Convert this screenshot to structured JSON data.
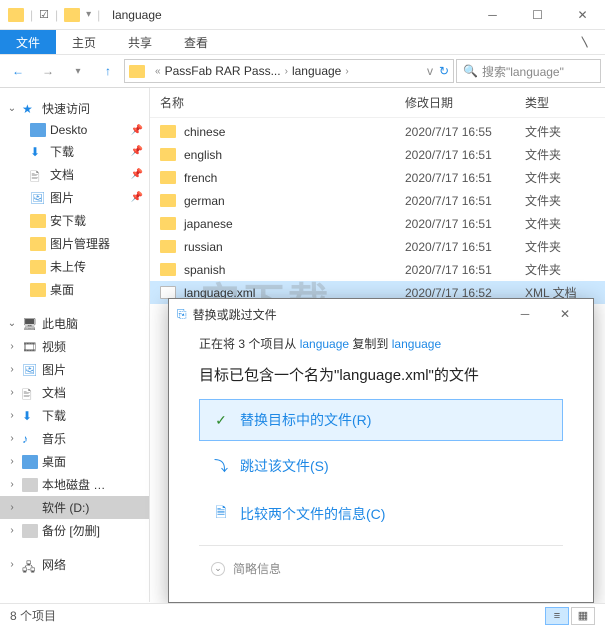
{
  "titlebar": {
    "title": "language"
  },
  "ribbon": {
    "file": "文件",
    "home": "主页",
    "share": "共享",
    "view": "查看"
  },
  "breadcrumb": {
    "seg1": "PassFab RAR Pass...",
    "seg2": "language"
  },
  "search": {
    "placeholder": "搜索\"language\""
  },
  "sidebar": {
    "quick": "快速访问",
    "desktop": "Deskto",
    "downloads": "下载",
    "documents": "文档",
    "pictures": "图片",
    "axz": "安下载",
    "picmgr": "图片管理器",
    "notup": "未上传",
    "desk2": "桌面",
    "thispc": "此电脑",
    "video": "视频",
    "pictures2": "图片",
    "documents2": "文档",
    "downloads2": "下载",
    "music": "音乐",
    "desk3": "桌面",
    "cdisk": "本地磁盘 …",
    "ddisk": "软件 (D:)",
    "backup": "备份 [勿删]",
    "network": "网络"
  },
  "columns": {
    "name": "名称",
    "date": "修改日期",
    "type": "类型"
  },
  "files": [
    {
      "name": "chinese",
      "date": "2020/7/17 16:55",
      "type": "文件夹"
    },
    {
      "name": "english",
      "date": "2020/7/17 16:51",
      "type": "文件夹"
    },
    {
      "name": "french",
      "date": "2020/7/17 16:51",
      "type": "文件夹"
    },
    {
      "name": "german",
      "date": "2020/7/17 16:51",
      "type": "文件夹"
    },
    {
      "name": "japanese",
      "date": "2020/7/17 16:51",
      "type": "文件夹"
    },
    {
      "name": "russian",
      "date": "2020/7/17 16:51",
      "type": "文件夹"
    },
    {
      "name": "spanish",
      "date": "2020/7/17 16:51",
      "type": "文件夹"
    },
    {
      "name": "language.xml",
      "date": "2020/7/17 16:52",
      "type": "XML 文档",
      "xml": true
    }
  ],
  "dialog": {
    "title": "替换或跳过文件",
    "status_prefix": "正在将 3 个项目从 ",
    "status_src": "language",
    "status_mid": " 复制到 ",
    "status_dst": "language",
    "heading": "目标已包含一个名为\"language.xml\"的文件",
    "opt_replace": "替换目标中的文件(R)",
    "opt_skip": "跳过该文件(S)",
    "opt_compare": "比较两个文件的信息(C)",
    "more": "简略信息"
  },
  "status": {
    "count": "8 个项目"
  },
  "watermark": "安下载"
}
